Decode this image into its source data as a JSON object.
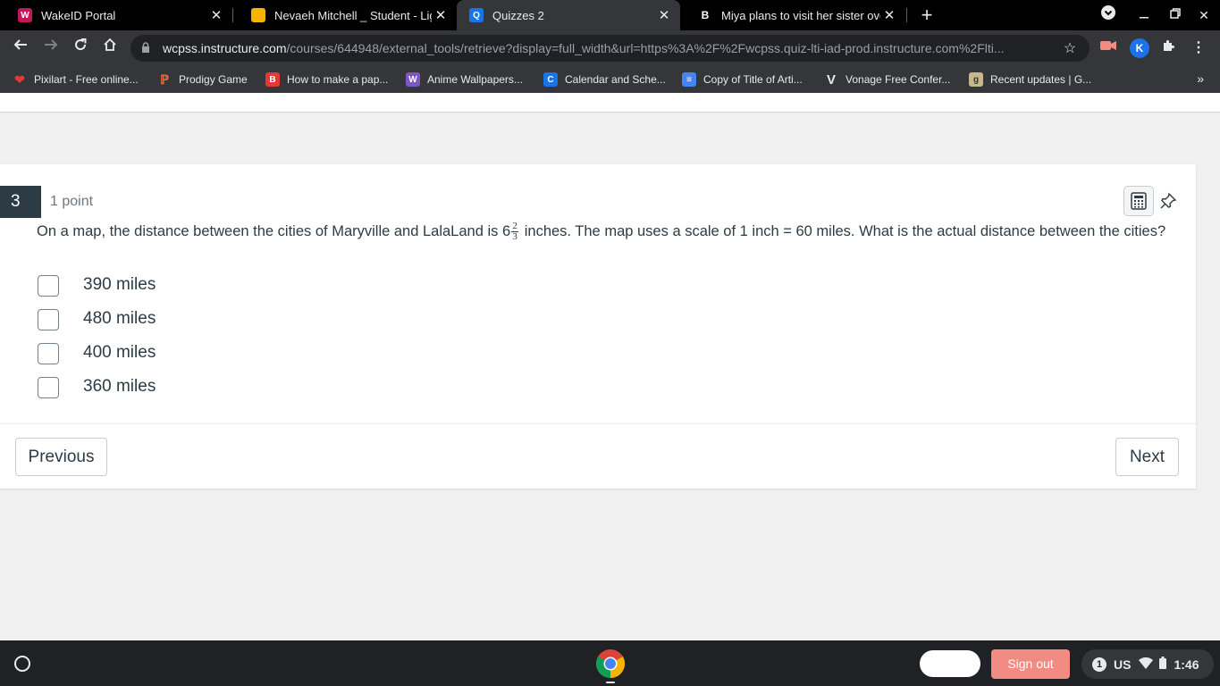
{
  "browser": {
    "tabs": [
      {
        "title": "WakeID Portal",
        "favicon": "wakeid-icon",
        "color": "#c2185b",
        "active": false
      },
      {
        "title": "Nevaeh Mitchell _ Student - Ligon",
        "favicon": "slides-icon",
        "color": "#f4b400",
        "active": false
      },
      {
        "title": "Quizzes 2",
        "favicon": "quizzes-icon",
        "color": "#1a73e8",
        "active": true
      },
      {
        "title": "Miya plans to visit her sister over",
        "favicon": "brainly-icon",
        "color": "#000000",
        "active": false
      }
    ],
    "url_host": "wcpss.instructure.com",
    "url_rest": "/courses/644948/external_tools/retrieve?display=full_width&url=https%3A%2F%2Fwcpss.quiz-lti-iad-prod.instructure.com%2Flti...",
    "extension_k_letter": "K",
    "bookmarks": [
      {
        "label": "Pixilart - Free online...",
        "icon": "heart-icon",
        "color": "#e53935"
      },
      {
        "label": "Prodigy Game",
        "icon": "prodigy-icon",
        "color": "#ff7043"
      },
      {
        "label": "How to make a pap...",
        "icon": "b-icon",
        "color": "#e53935"
      },
      {
        "label": "Anime Wallpapers...",
        "icon": "wallpapers-icon",
        "color": "#7e57c2"
      },
      {
        "label": "Calendar and Sche...",
        "icon": "calendar-icon",
        "color": "#1a73e8"
      },
      {
        "label": "Copy of Title of Arti...",
        "icon": "docs-icon",
        "color": "#4285f4"
      },
      {
        "label": "Vonage Free Confer...",
        "icon": "vonage-icon",
        "color": "#e8eaed"
      },
      {
        "label": "Recent updates | G...",
        "icon": "g-icon",
        "color": "#c8b88a"
      }
    ]
  },
  "quiz": {
    "question_number": "3",
    "points": "1 point",
    "prompt_before": "On a map, the distance between the cities of Maryville and LalaLand is 6",
    "fraction_numerator": "2",
    "fraction_denominator": "3",
    "prompt_after": " inches.  The map uses a scale of 1 inch = 60 miles.  What is the actual distance between the cities?",
    "choices": [
      "390 miles",
      "480 miles",
      "400 miles",
      "360 miles"
    ],
    "previous_label": "Previous",
    "next_label": "Next"
  },
  "shelf": {
    "sign_out_label": "Sign out",
    "notification_count": "1",
    "keyboard_layout": "US",
    "time": "1:46"
  }
}
